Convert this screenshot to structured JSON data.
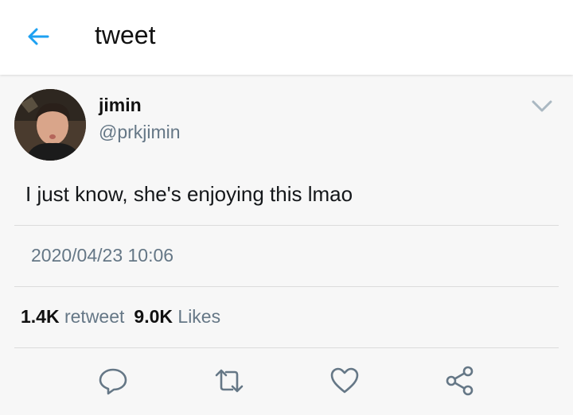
{
  "header": {
    "title": "tweet",
    "back_icon": "arrow-left-icon",
    "accent_color": "#1da1f2"
  },
  "tweet": {
    "author_name": "jimin",
    "author_handle": "@prkjimin",
    "text": "I just know, she's enjoying this lmao",
    "timestamp": "2020/04/23 10:06",
    "menu_icon": "chevron-down-icon"
  },
  "stats": {
    "retweet_count": "1.4K",
    "retweet_label": "retweet",
    "likes_count": "9.0K",
    "likes_label": "Likes"
  },
  "actions": [
    "reply-icon",
    "retweet-icon",
    "like-icon",
    "share-icon"
  ]
}
